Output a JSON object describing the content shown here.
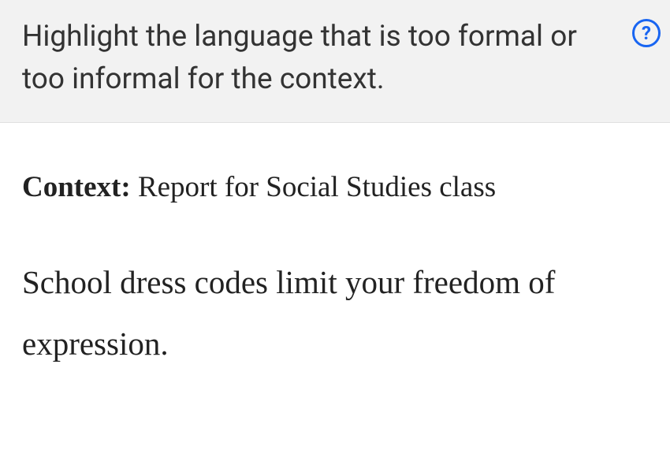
{
  "header": {
    "instruction": "Highlight the language that is too formal or too informal for the context.",
    "help_label": "?"
  },
  "content": {
    "context_label": "Context:",
    "context_value": " Report for Social Studies class",
    "sentence": "School dress codes limit your freedom of expression."
  }
}
